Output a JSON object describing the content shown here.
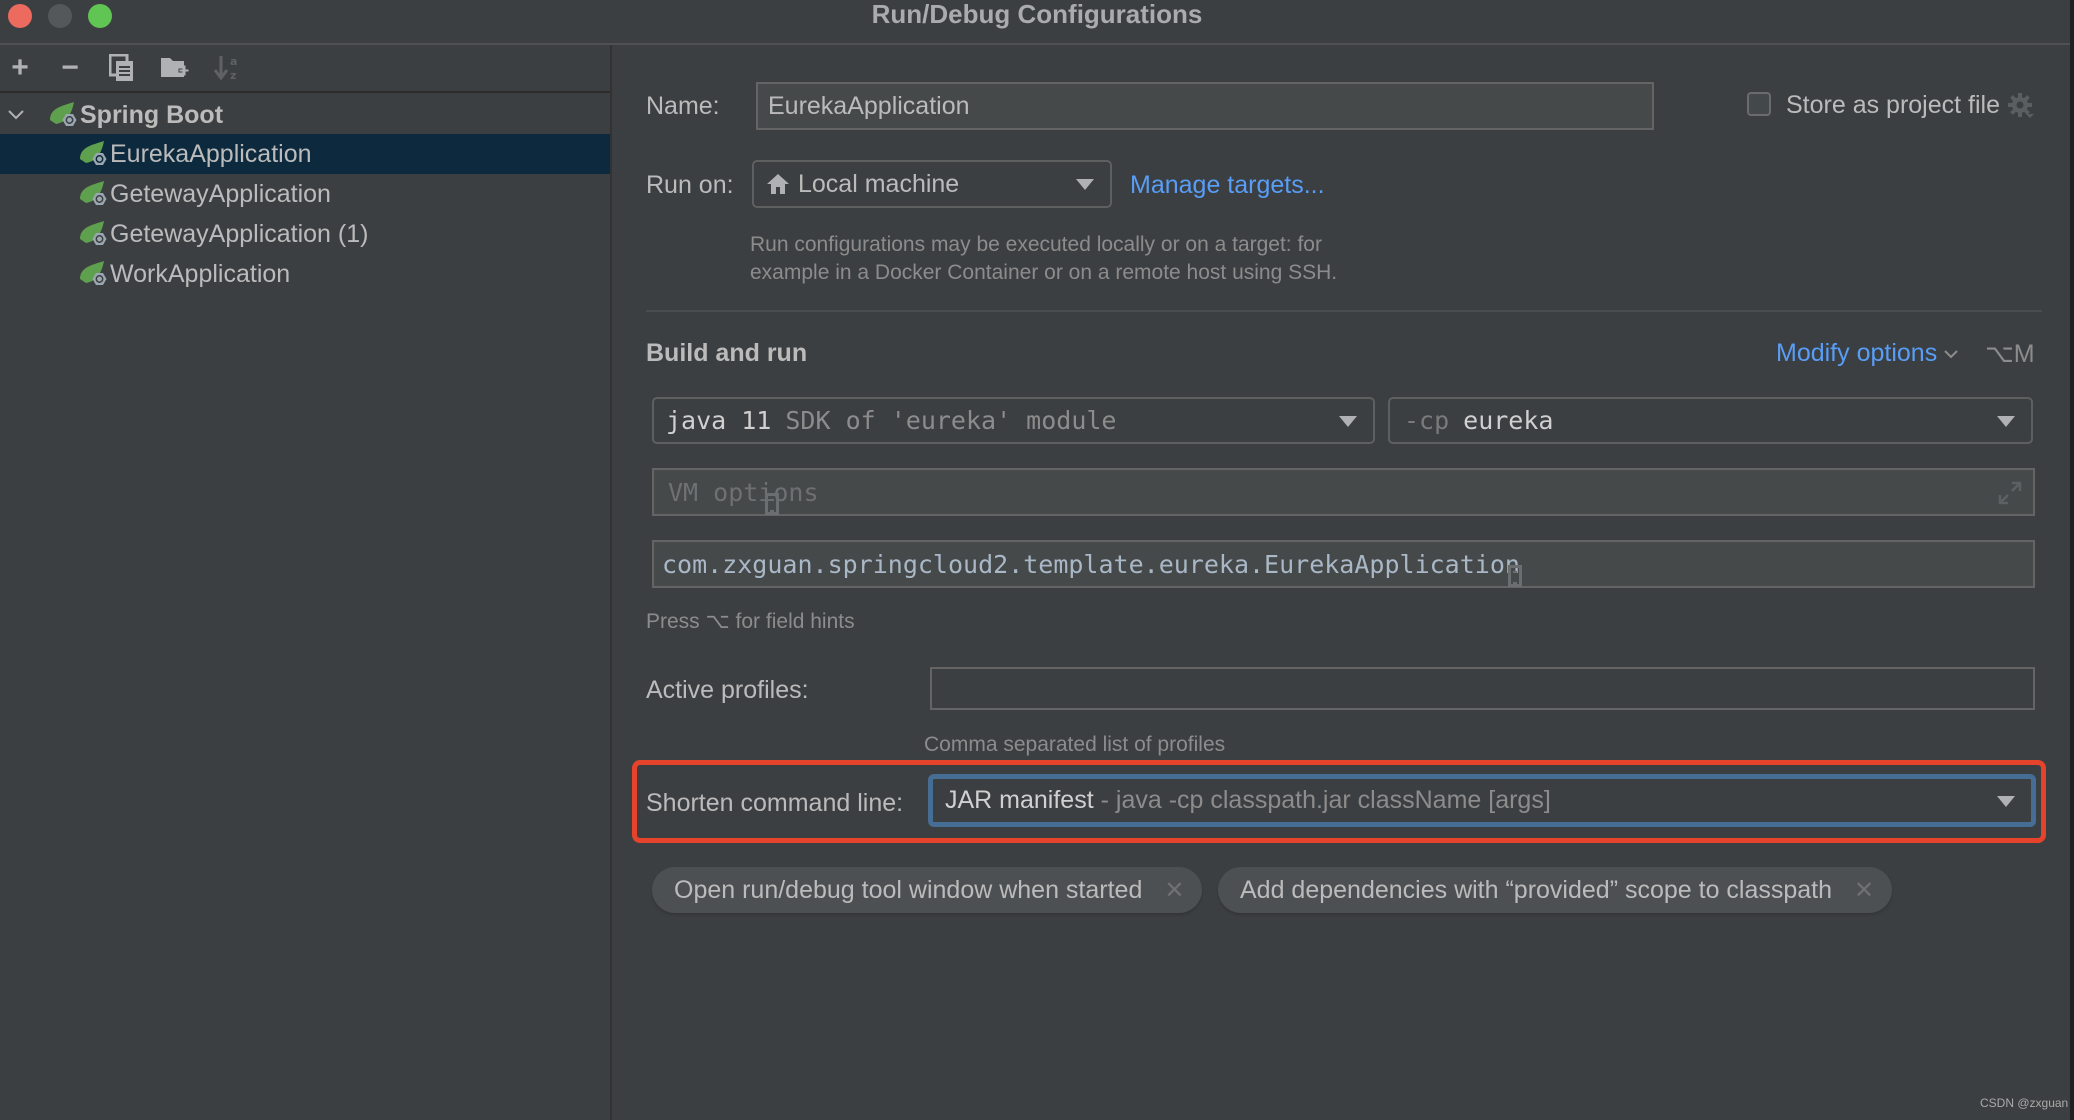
{
  "window": {
    "title": "Run/Debug Configurations"
  },
  "toolbar": {
    "add": "+",
    "remove": "−",
    "copy_icon": "copy-icon",
    "new_folder_icon": "folder-add-icon",
    "sort_icon": "sort-alpha-icon"
  },
  "tree": {
    "group": {
      "label": "Spring Boot",
      "expanded": true
    },
    "items": [
      {
        "label": "EurekaApplication",
        "selected": true
      },
      {
        "label": "GetewayApplication",
        "selected": false
      },
      {
        "label": "GetewayApplication (1)",
        "selected": false
      },
      {
        "label": "WorkApplication",
        "selected": false
      }
    ]
  },
  "form": {
    "name_label": "Name:",
    "name_value": "EurekaApplication",
    "store_as_project_file": {
      "label": "Store as project file",
      "checked": false
    },
    "run_on_label": "Run on:",
    "run_on_value": "Local machine",
    "manage_targets": "Manage targets...",
    "run_on_hint_1": "Run configurations may be executed locally or on a target: for",
    "run_on_hint_2": "example in a Docker Container or on a remote host using SSH.",
    "build_and_run_title": "Build and run",
    "modify_options": "Modify options",
    "modify_options_shortcut": "⌥M",
    "sdk_value_main": "java 11",
    "sdk_value_hint": "SDK of 'eureka' module",
    "cp_prefix": "-cp",
    "cp_value": "eureka",
    "vm_options_placeholder": "VM options",
    "main_class_value": "com.zxguan.springcloud2.template.eureka.EurekaApplication",
    "field_hints_text": "Press ⌥ for field hints",
    "active_profiles_label": "Active profiles:",
    "active_profiles_value": "",
    "active_profiles_hint": "Comma separated list of profiles",
    "shorten_label": "Shorten command line:",
    "shorten_value_main": "JAR manifest",
    "shorten_value_hint": " - java -cp classpath.jar className [args]",
    "chips": [
      {
        "label": "Open run/debug tool window when started"
      },
      {
        "label": "Add dependencies with “provided” scope to classpath"
      }
    ]
  },
  "colors": {
    "background": "#3c3f41",
    "selection": "#0d293e",
    "link": "#589df6",
    "highlight_box": "#e5432c",
    "focus_border": "#466d94",
    "spring_green": "#5fa04e"
  },
  "watermark": "CSDN @zxguan"
}
